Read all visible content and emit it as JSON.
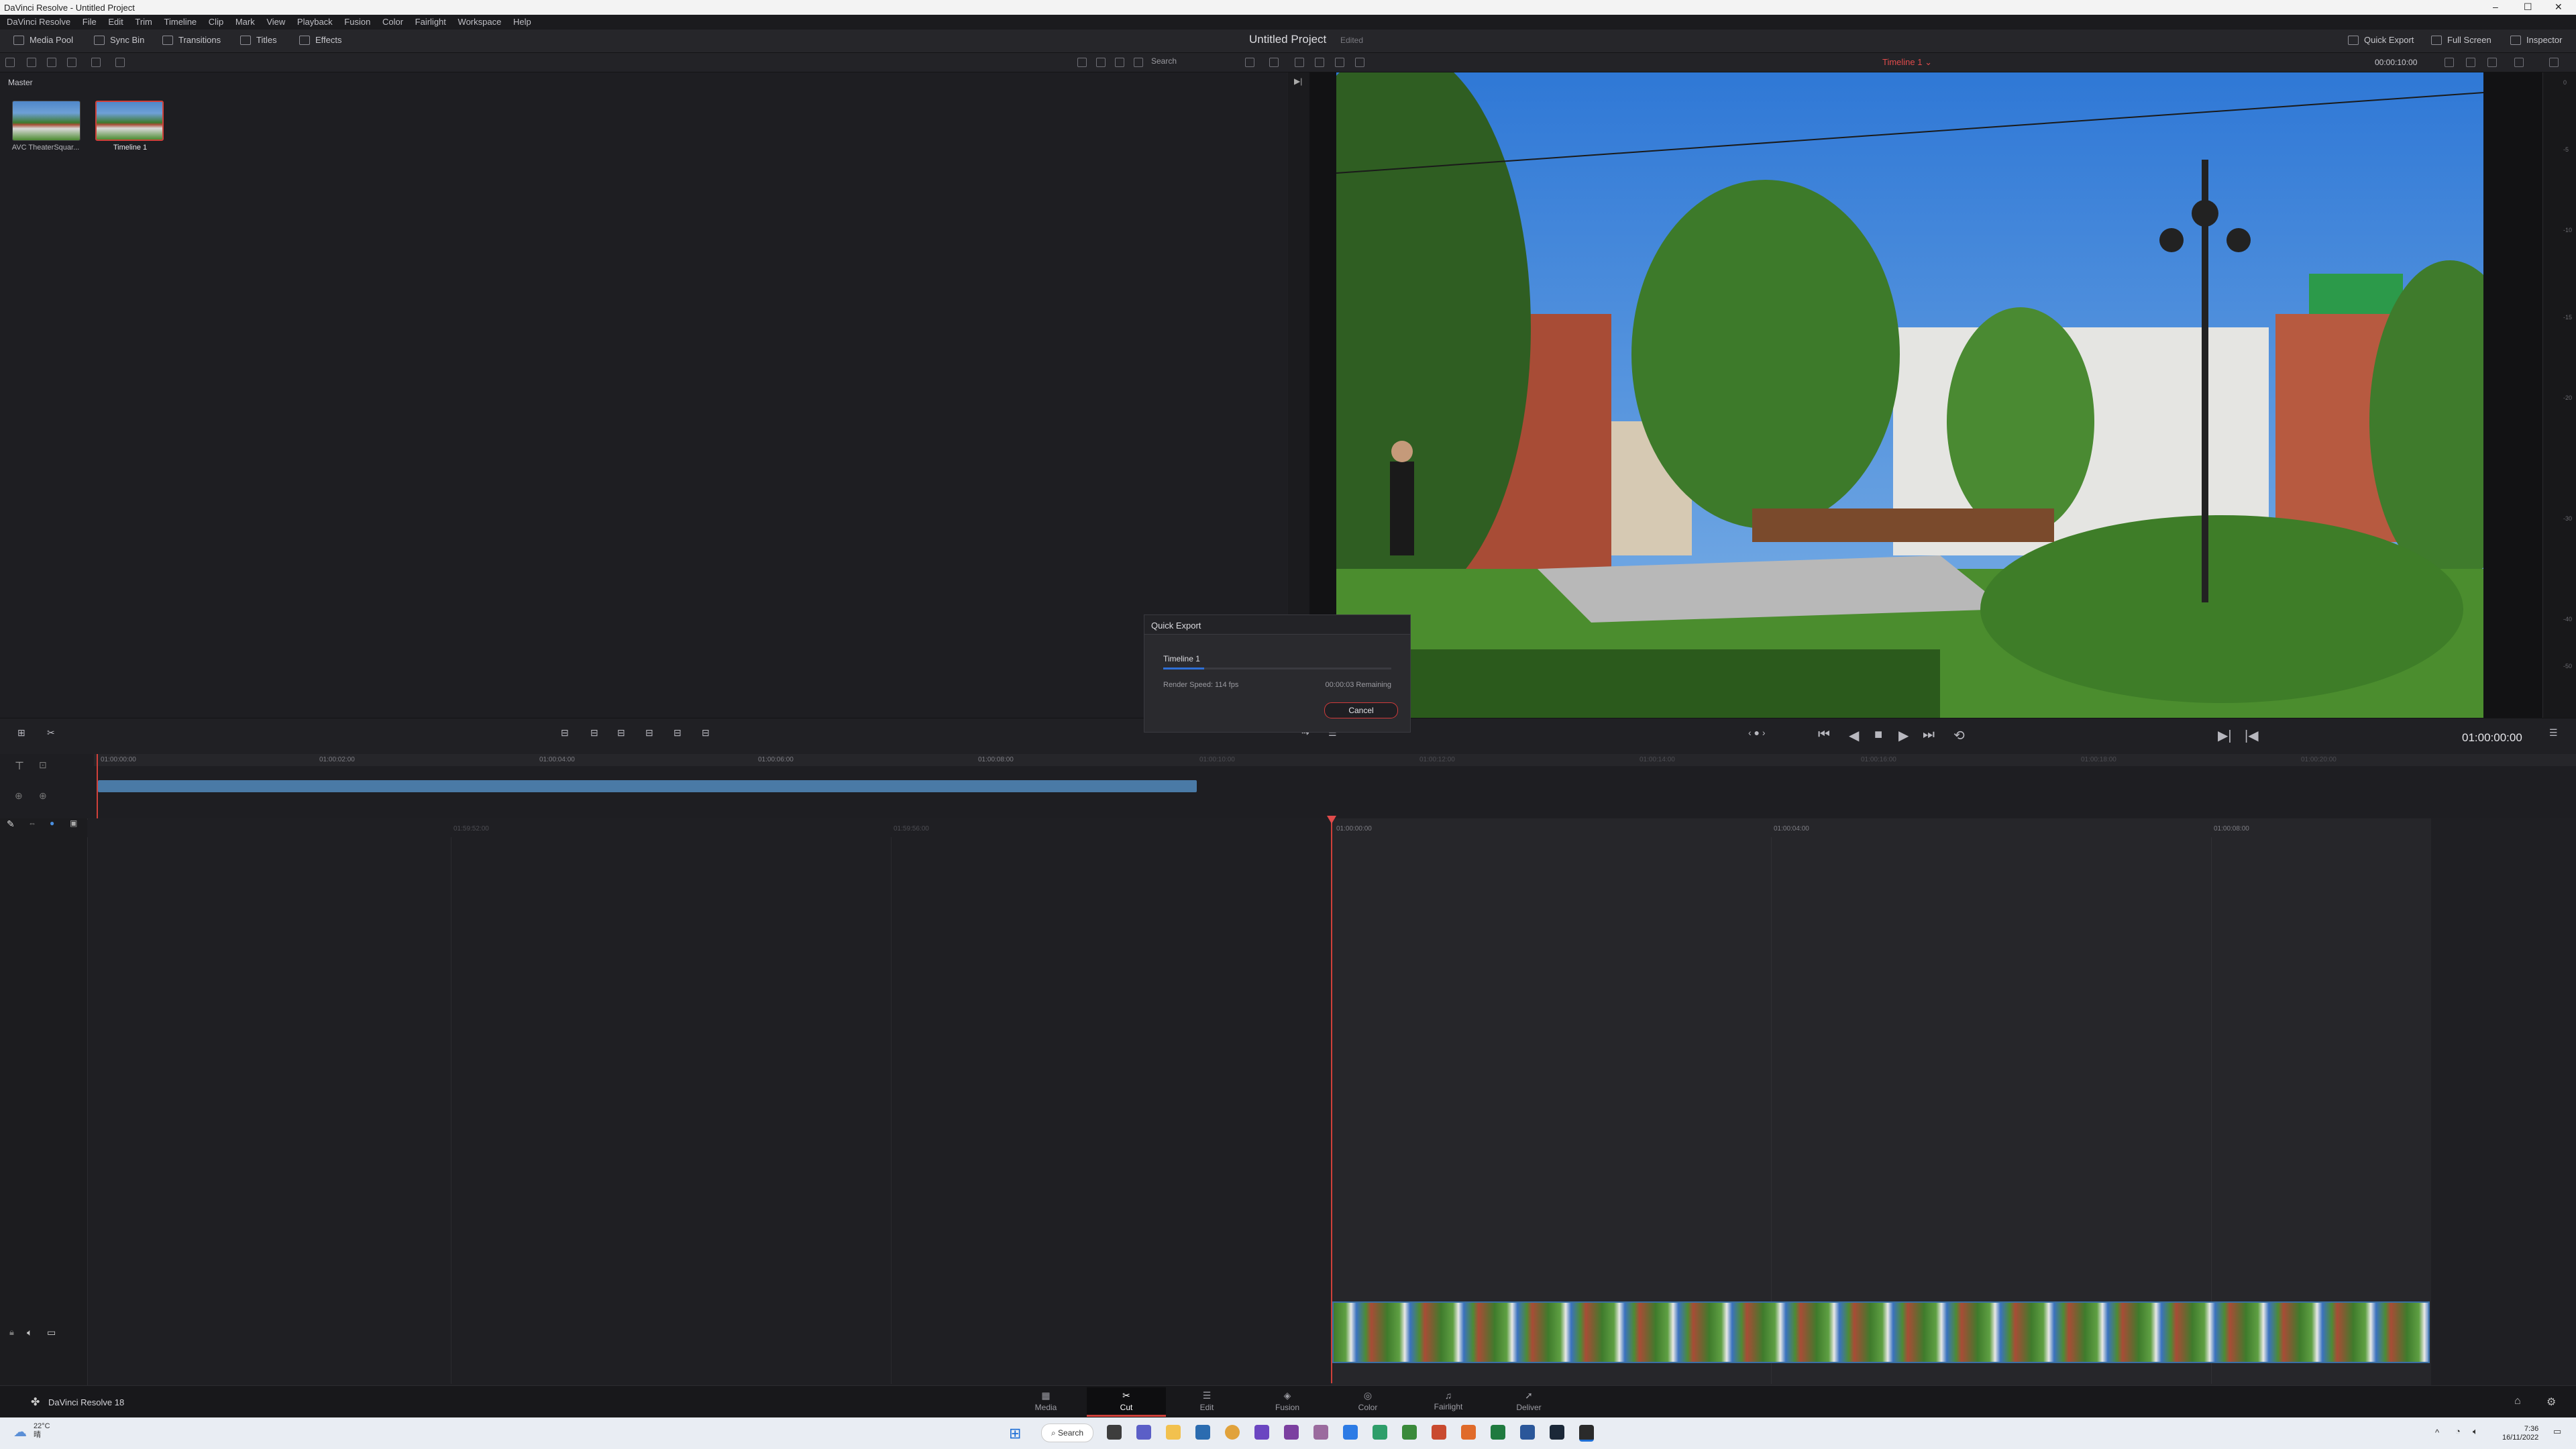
{
  "window": {
    "title": "DaVinci Resolve - Untitled Project"
  },
  "menu": [
    "DaVinci Resolve",
    "File",
    "Edit",
    "Trim",
    "Timeline",
    "Clip",
    "Mark",
    "View",
    "Playback",
    "Fusion",
    "Color",
    "Fairlight",
    "Workspace",
    "Help"
  ],
  "toolbar": {
    "media_pool": "Media Pool",
    "sync_bin": "Sync Bin",
    "transitions": "Transitions",
    "titles": "Titles",
    "effects": "Effects",
    "project_title": "Untitled Project",
    "project_state": "Edited",
    "quick_export": "Quick Export",
    "full_screen": "Full Screen",
    "inspector": "Inspector"
  },
  "subbar": {
    "search_placeholder": "Search",
    "timeline_selector": "Timeline 1 ⌄",
    "duration": "00:00:10:00"
  },
  "media_pool": {
    "bin": "Master",
    "items": [
      {
        "label": "AVC TheaterSquar..."
      },
      {
        "label": "Timeline 1"
      }
    ]
  },
  "meter_scale": [
    "0",
    "-5",
    "-10",
    "-15",
    "-20",
    "-30",
    "-40",
    "-50"
  ],
  "quick_export": {
    "title": "Quick Export",
    "timeline": "Timeline 1",
    "progress": 0.18,
    "render_speed": "Render Speed: 114 fps",
    "remaining": "00:00:03 Remaining",
    "cancel": "Cancel"
  },
  "transport": {
    "timecode": "01:00:00:00"
  },
  "upper_ruler": [
    "01:00:00:00",
    "01:00:02:00",
    "01:00:04:00",
    "01:00:06:00",
    "01:00:08:00",
    "01:00:10:00",
    "01:00:12:00",
    "01:00:14:00",
    "01:00:16:00",
    "01:00:18:00",
    "01:00:20:00"
  ],
  "lower_ruler": [
    "01:59:52:00",
    "01:59:56:00",
    "01:00:00:00",
    "01:00:04:00",
    "01:00:08:00"
  ],
  "clip_overlay": "",
  "pages": [
    {
      "label": "Media",
      "icon": "▦"
    },
    {
      "label": "Cut",
      "icon": "✂"
    },
    {
      "label": "Edit",
      "icon": "☰"
    },
    {
      "label": "Fusion",
      "icon": "◈"
    },
    {
      "label": "Color",
      "icon": "◎"
    },
    {
      "label": "Fairlight",
      "icon": "♫"
    },
    {
      "label": "Deliver",
      "icon": "➚"
    }
  ],
  "footer": {
    "app_name": "DaVinci Resolve 18"
  },
  "taskbar": {
    "weather_temp": "22°C",
    "weather_desc": "晴",
    "search": "Search",
    "time": "7:36",
    "date": "16/11/2022"
  }
}
